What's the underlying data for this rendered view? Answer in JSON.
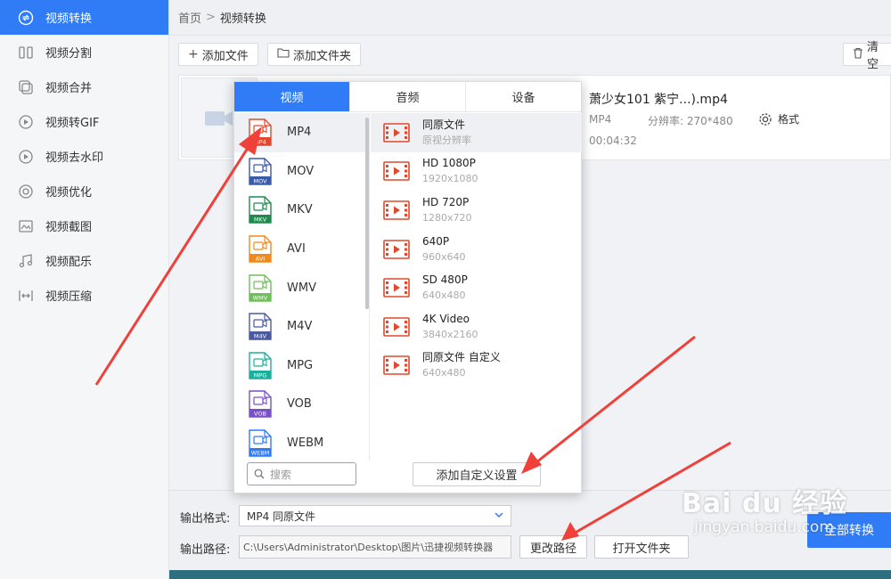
{
  "sidebar": {
    "items": [
      {
        "label": "视频转换",
        "icon": "convert-icon",
        "active": true
      },
      {
        "label": "视频分割",
        "icon": "split-icon",
        "active": false
      },
      {
        "label": "视频合并",
        "icon": "merge-icon",
        "active": false
      },
      {
        "label": "视频转GIF",
        "icon": "gif-icon",
        "active": false
      },
      {
        "label": "视频去水印",
        "icon": "watermark-remove-icon",
        "active": false
      },
      {
        "label": "视频优化",
        "icon": "optimize-icon",
        "active": false
      },
      {
        "label": "视频截图",
        "icon": "screenshot-icon",
        "active": false
      },
      {
        "label": "视频配乐",
        "icon": "music-icon",
        "active": false
      },
      {
        "label": "视频压缩",
        "icon": "compress-icon",
        "active": false
      }
    ]
  },
  "breadcrumb": {
    "home": "首页",
    "separator": ">",
    "current": "视频转换"
  },
  "toolbar": {
    "add_file": "添加文件",
    "add_folder": "添加文件夹",
    "clear": "清空"
  },
  "file": {
    "name": "萧少女101 紫宁...).mp4",
    "format": "MP4",
    "resolution": "分辨率: 270*480",
    "duration": "00:04:32",
    "format_button": "格式"
  },
  "popup": {
    "tabs": [
      {
        "label": "视频",
        "active": true
      },
      {
        "label": "音频",
        "active": false
      },
      {
        "label": "设备",
        "active": false
      }
    ],
    "formats": [
      {
        "label": "MP4",
        "badge": "MP4",
        "color": "#e0492d",
        "active": true
      },
      {
        "label": "MOV",
        "badge": "MOV",
        "color": "#3a5ba8",
        "active": false
      },
      {
        "label": "MKV",
        "badge": "MKV",
        "color": "#1f8a4c",
        "active": false
      },
      {
        "label": "AVI",
        "badge": "AVI",
        "color": "#f08a1c",
        "active": false
      },
      {
        "label": "WMV",
        "badge": "WMV",
        "color": "#6fbf5a",
        "active": false
      },
      {
        "label": "M4V",
        "badge": "M4V",
        "color": "#4a5a9c",
        "active": false
      },
      {
        "label": "MPG",
        "badge": "MPG",
        "color": "#1eae9e",
        "active": false
      },
      {
        "label": "VOB",
        "badge": "VOB",
        "color": "#7a4fc8",
        "active": false
      },
      {
        "label": "WEBM",
        "badge": "WEBM",
        "color": "#2f7cf6",
        "active": false
      }
    ],
    "presets": [
      {
        "name": "同原文件",
        "sub": "原视分辨率",
        "active": true
      },
      {
        "name": "HD 1080P",
        "sub": "1920x1080",
        "active": false
      },
      {
        "name": "HD 720P",
        "sub": "1280x720",
        "active": false
      },
      {
        "name": "640P",
        "sub": "960x640",
        "active": false
      },
      {
        "name": "SD 480P",
        "sub": "640x480",
        "active": false
      },
      {
        "name": "4K Video",
        "sub": "3840x2160",
        "active": false
      },
      {
        "name": "同原文件 自定义",
        "sub": "640x480",
        "active": false
      }
    ],
    "search_placeholder": "搜索",
    "add_custom": "添加自定义设置"
  },
  "bottom": {
    "format_label": "输出格式:",
    "format_value": "MP4   同原文件",
    "path_label": "输出路径:",
    "path_value": "C:\\Users\\Administrator\\Desktop\\图片\\迅捷视频转换器",
    "change_path": "更改路径",
    "open_folder": "打开文件夹",
    "convert_all": "全部转换"
  },
  "watermark": {
    "logo": "Bai du 经验",
    "url": "jingyan.baidu.com"
  },
  "colors": {
    "accent": "#2f7cf6",
    "arrow": "#f0403a",
    "preset_icon": "#e0492d"
  }
}
